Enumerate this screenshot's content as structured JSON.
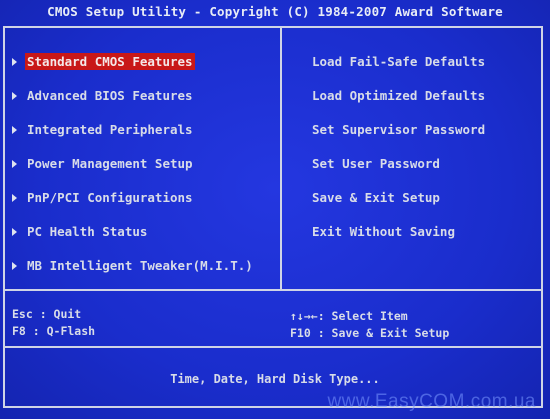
{
  "title": "CMOS Setup Utility - Copyright (C) 1984-2007 Award Software",
  "left_menu": [
    {
      "label": "Standard CMOS Features",
      "selected": true
    },
    {
      "label": "Advanced BIOS Features",
      "selected": false
    },
    {
      "label": "Integrated Peripherals",
      "selected": false
    },
    {
      "label": "Power Management Setup",
      "selected": false
    },
    {
      "label": "PnP/PCI Configurations",
      "selected": false
    },
    {
      "label": "PC Health Status",
      "selected": false
    },
    {
      "label": "MB Intelligent Tweaker(M.I.T.)",
      "selected": false
    }
  ],
  "right_menu": [
    {
      "label": "Load Fail-Safe Defaults"
    },
    {
      "label": "Load Optimized Defaults"
    },
    {
      "label": "Set Supervisor Password"
    },
    {
      "label": "Set User Password"
    },
    {
      "label": "Save & Exit Setup"
    },
    {
      "label": "Exit Without Saving"
    }
  ],
  "help": {
    "esc": "Esc : Quit",
    "f8": "F8  : Q-Flash",
    "arrows": "↑↓→←: Select Item",
    "f10": "F10 : Save & Exit Setup"
  },
  "status_text": "Time, Date, Hard Disk Type...",
  "watermark": "www.EasyCOM.com.ua",
  "colors": {
    "background": "#1a2fd0",
    "text": "#d8dce8",
    "highlight": "#c81818"
  }
}
